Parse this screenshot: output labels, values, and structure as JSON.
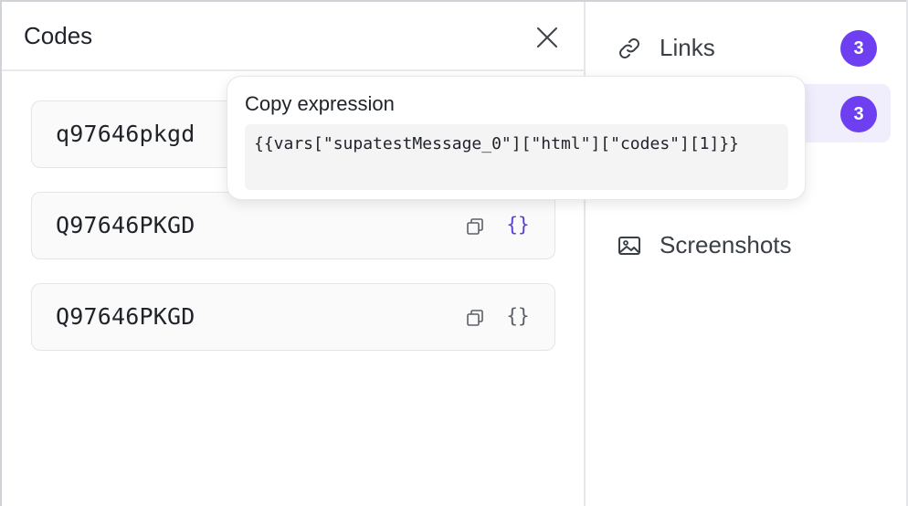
{
  "codes_panel": {
    "title": "Codes",
    "rows": [
      {
        "value": "q97646pkgd"
      },
      {
        "value": "Q97646PKGD"
      },
      {
        "value": "Q97646PKGD"
      }
    ],
    "braces_glyph": "{}"
  },
  "sidebar": {
    "items": [
      {
        "label": "Links",
        "badge": "3",
        "icon": "link-icon"
      },
      {
        "label": "",
        "badge": "3",
        "icon": ""
      },
      {
        "label": "Screenshots",
        "badge": "",
        "icon": "image-icon"
      }
    ]
  },
  "tooltip": {
    "title": "Copy expression",
    "code": "{{vars[\"supatestMessage_0\"][\"html\"][\"codes\"][1]}}"
  },
  "colors": {
    "accent": "#6d3ff0",
    "accent_text": "#5b3fd6",
    "active_bg": "#f0edfd"
  }
}
